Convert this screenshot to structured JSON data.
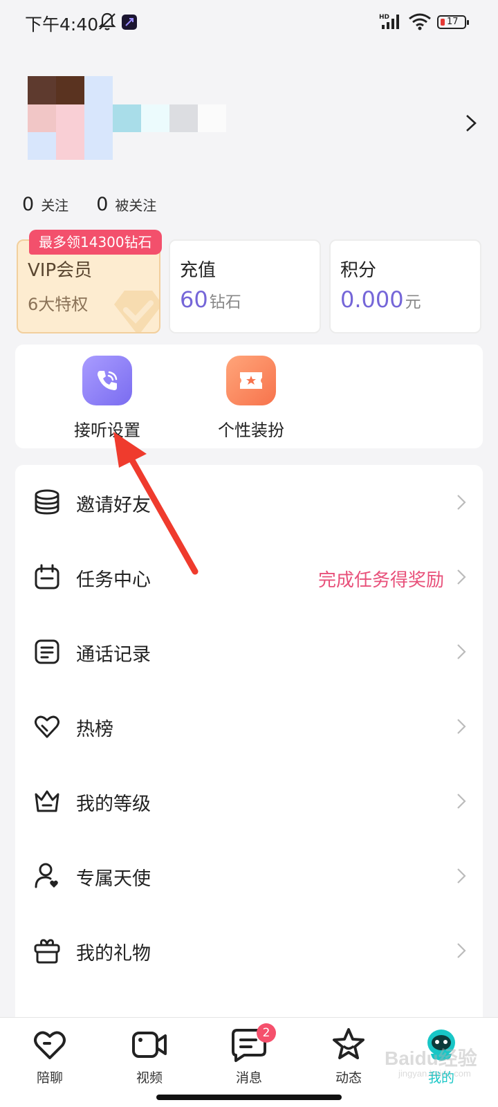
{
  "status_bar": {
    "time": "下午4:40",
    "battery": "17",
    "network": "HD"
  },
  "profile": {
    "following_count": "0",
    "following_label": "关注",
    "followers_count": "0",
    "followers_label": "被关注"
  },
  "cards": {
    "vip_badge": "最多领14300钻石",
    "vip_title": "VIP会员",
    "vip_sub": "6大特权",
    "recharge_title": "充值",
    "recharge_value": "60",
    "recharge_unit": "钻石",
    "points_title": "积分",
    "points_value": "0.000",
    "points_unit": "元"
  },
  "quick_actions": [
    {
      "label": "接听设置",
      "icon": "phone-call-icon"
    },
    {
      "label": "个性装扮",
      "icon": "dress-up-ticket-icon"
    }
  ],
  "menu": [
    {
      "label": "邀请好友",
      "icon": "coins-stack-icon",
      "extra": ""
    },
    {
      "label": "任务中心",
      "icon": "calendar-icon",
      "extra": "完成任务得奖励"
    },
    {
      "label": "通话记录",
      "icon": "document-lines-icon",
      "extra": ""
    },
    {
      "label": "热榜",
      "icon": "heart-outline-icon",
      "extra": ""
    },
    {
      "label": "我的等级",
      "icon": "crown-icon",
      "extra": ""
    },
    {
      "label": "专属天使",
      "icon": "user-heart-icon",
      "extra": ""
    },
    {
      "label": "我的礼物",
      "icon": "gift-box-icon",
      "extra": ""
    }
  ],
  "bottom_nav": [
    {
      "label": "陪聊",
      "icon": "heart-icon"
    },
    {
      "label": "视频",
      "icon": "video-camera-icon"
    },
    {
      "label": "消息",
      "icon": "message-icon",
      "badge": "2"
    },
    {
      "label": "动态",
      "icon": "star-icon"
    },
    {
      "label": "我的",
      "icon": "mascot-icon"
    }
  ],
  "watermark": {
    "text": "Baidu经验",
    "sub": "jingyan.baidu.com"
  },
  "colors": {
    "accent_purple": "#7566d8",
    "badge_pink": "#f3506c",
    "task_pink": "#e8507a",
    "nav_active": "#18c6c6",
    "vip_bg": "#fdecd0"
  }
}
